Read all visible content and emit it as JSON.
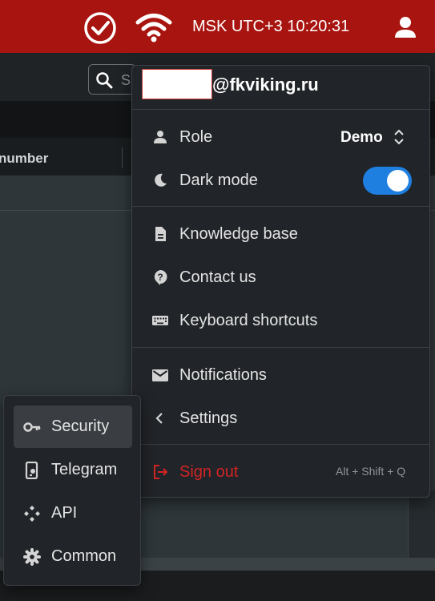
{
  "status_bar": {
    "clock": "MSK UTC+3 10:20:31",
    "icons": [
      "check-circle-icon",
      "wifi-icon",
      "user-icon"
    ],
    "color": "#a8140f"
  },
  "background_app": {
    "search_placeholder": "S",
    "column_header": "number"
  },
  "account_menu": {
    "email_suffix": "@fkviking.ru",
    "role_label": "Role",
    "role_value": "Demo",
    "dark_mode_label": "Dark mode",
    "dark_mode_on": true,
    "items": [
      {
        "label": "Knowledge base",
        "icon": "document-icon"
      },
      {
        "label": "Contact us",
        "icon": "help-icon"
      },
      {
        "label": "Keyboard shortcuts",
        "icon": "keyboard-icon"
      },
      {
        "label": "Notifications",
        "icon": "mail-icon"
      },
      {
        "label": "Settings",
        "icon": "chevron-left-icon"
      }
    ],
    "sign_out": {
      "label": "Sign out",
      "shortcut": "Alt + Shift + Q"
    },
    "toggle_color": "#1f7fe0",
    "signout_color": "#d32424"
  },
  "settings_submenu": {
    "items": [
      {
        "label": "Security",
        "icon": "key-icon",
        "active": true
      },
      {
        "label": "Telegram",
        "icon": "phone-icon",
        "active": false
      },
      {
        "label": "API",
        "icon": "api-icon",
        "active": false
      },
      {
        "label": "Common",
        "icon": "gear-icon",
        "active": false
      }
    ]
  }
}
